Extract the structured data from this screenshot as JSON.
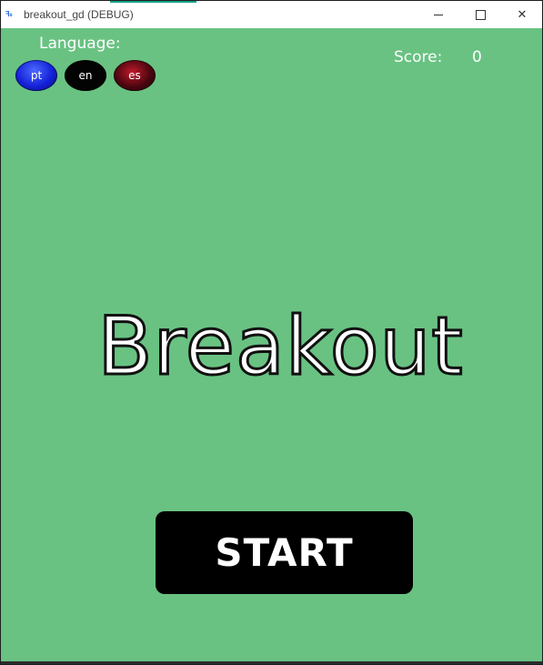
{
  "window": {
    "title": "breakout_gd (DEBUG)",
    "icon_text": "ꟻ₀",
    "minimize_icon": "minimize-icon",
    "maximize_icon": "maximize-icon",
    "close_glyph": "✕"
  },
  "language": {
    "label": "Language:",
    "options": [
      {
        "code": "pt",
        "color": "#1420d8"
      },
      {
        "code": "en",
        "color": "#030303"
      },
      {
        "code": "es",
        "color": "#4a0610"
      }
    ]
  },
  "score": {
    "label": "Score:",
    "value": "0"
  },
  "game": {
    "title": "Breakout",
    "start_label": "START",
    "background": "#69c282"
  }
}
